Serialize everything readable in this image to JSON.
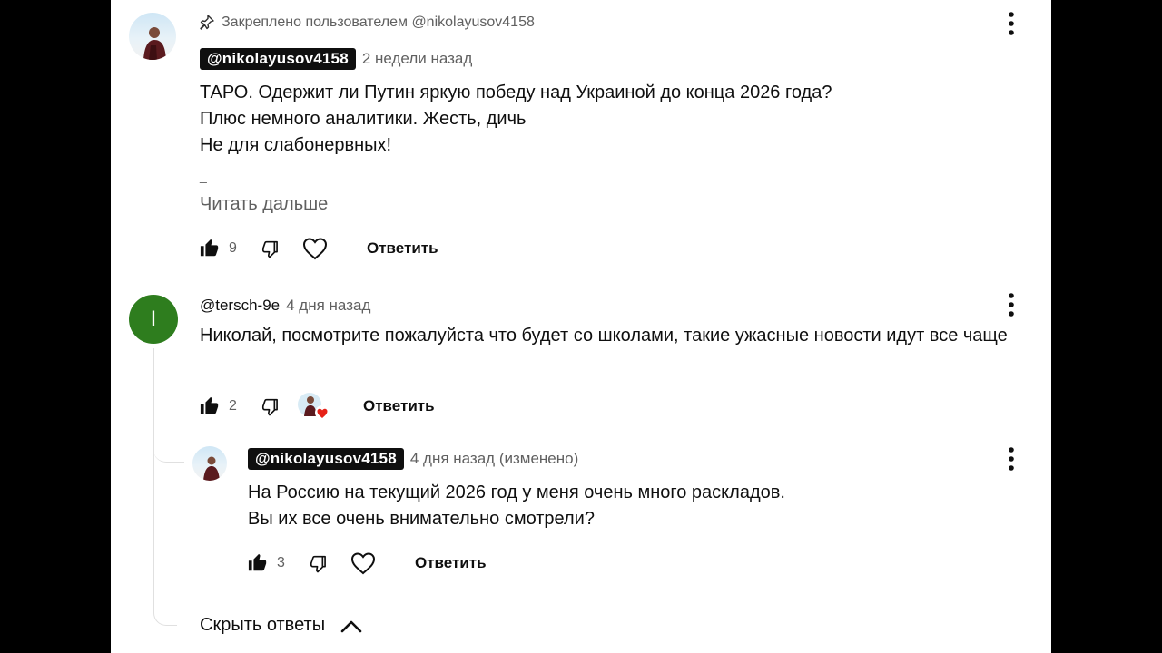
{
  "pinned_comment": {
    "pinned_label": "Закреплено пользователем @nikolayusov4158",
    "author": "@nikolayusov4158",
    "time": "2 недели назад",
    "lines": [
      "ТАРО. Одержит ли Путин яркую победу над Украиной до конца 2026 года?",
      "Плюс немного аналитики. Жесть, дичь",
      "Не для слабонервных!",
      "_"
    ],
    "read_more": "Читать дальше",
    "likes": "9",
    "reply_label": "Ответить"
  },
  "comment2": {
    "avatar_letter": "I",
    "author": "@tersch-9e",
    "time": "4 дня назад",
    "text": "Николай, посмотрите пожалуйста что будет со школами, такие ужасные новости идут все чаще",
    "likes": "2",
    "reply_label": "Ответить"
  },
  "reply1": {
    "author": "@nikolayusov4158",
    "time": "4 дня назад (изменено)",
    "lines": [
      "На Россию на текущий 2026 год у меня очень много раскладов.",
      "Вы их все очень внимательно смотрели?"
    ],
    "likes": "3",
    "reply_label": "Ответить"
  },
  "hide_replies": "Скрыть ответы",
  "colors": {
    "panel_bg": "#ffffff",
    "outer_bg": "#000000",
    "letter_avatar": "#2e7d1e",
    "heart_badge": "#e62117",
    "handle_badge": "#0f0f0f"
  }
}
